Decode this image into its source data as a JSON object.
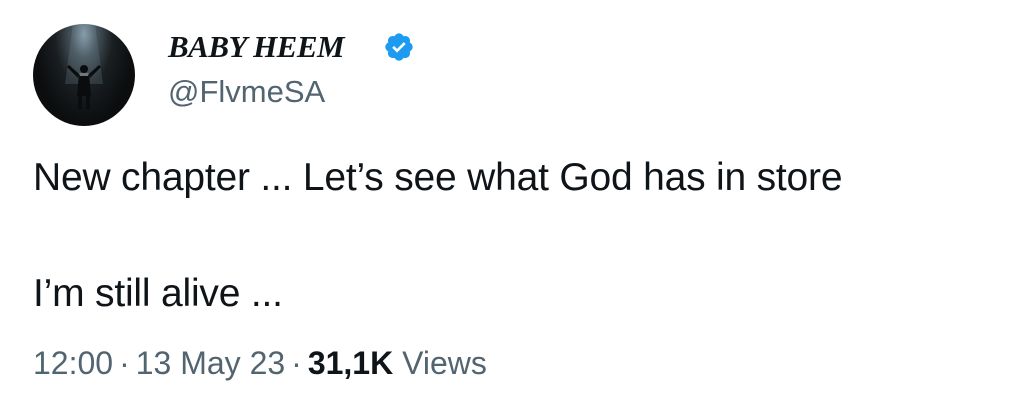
{
  "author": {
    "display_name": "BABY HEEM",
    "handle": "@FlvmeSA",
    "verified": true,
    "verified_color": "#1d9bf0",
    "avatar_icon": "person-on-stage-spotlight-avatar"
  },
  "tweet": {
    "line1": "New chapter ... Let’s see what God has in store",
    "line2": "I’m still alive ..."
  },
  "meta": {
    "time": "12:00",
    "separator": "·",
    "date": "13 May 23",
    "views_count": "31,1K",
    "views_label": "Views"
  }
}
